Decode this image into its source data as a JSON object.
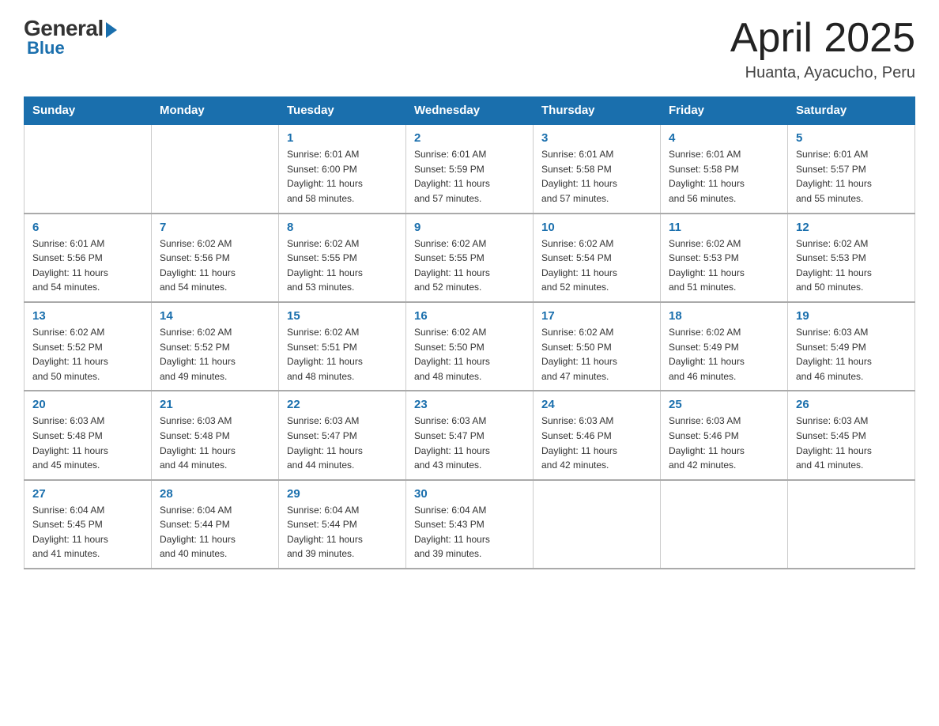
{
  "logo": {
    "general": "General",
    "blue": "Blue"
  },
  "title": {
    "month": "April 2025",
    "location": "Huanta, Ayacucho, Peru"
  },
  "days_header": [
    "Sunday",
    "Monday",
    "Tuesday",
    "Wednesday",
    "Thursday",
    "Friday",
    "Saturday"
  ],
  "weeks": [
    [
      {
        "day": "",
        "info": ""
      },
      {
        "day": "",
        "info": ""
      },
      {
        "day": "1",
        "info": "Sunrise: 6:01 AM\nSunset: 6:00 PM\nDaylight: 11 hours\nand 58 minutes."
      },
      {
        "day": "2",
        "info": "Sunrise: 6:01 AM\nSunset: 5:59 PM\nDaylight: 11 hours\nand 57 minutes."
      },
      {
        "day": "3",
        "info": "Sunrise: 6:01 AM\nSunset: 5:58 PM\nDaylight: 11 hours\nand 57 minutes."
      },
      {
        "day": "4",
        "info": "Sunrise: 6:01 AM\nSunset: 5:58 PM\nDaylight: 11 hours\nand 56 minutes."
      },
      {
        "day": "5",
        "info": "Sunrise: 6:01 AM\nSunset: 5:57 PM\nDaylight: 11 hours\nand 55 minutes."
      }
    ],
    [
      {
        "day": "6",
        "info": "Sunrise: 6:01 AM\nSunset: 5:56 PM\nDaylight: 11 hours\nand 54 minutes."
      },
      {
        "day": "7",
        "info": "Sunrise: 6:02 AM\nSunset: 5:56 PM\nDaylight: 11 hours\nand 54 minutes."
      },
      {
        "day": "8",
        "info": "Sunrise: 6:02 AM\nSunset: 5:55 PM\nDaylight: 11 hours\nand 53 minutes."
      },
      {
        "day": "9",
        "info": "Sunrise: 6:02 AM\nSunset: 5:55 PM\nDaylight: 11 hours\nand 52 minutes."
      },
      {
        "day": "10",
        "info": "Sunrise: 6:02 AM\nSunset: 5:54 PM\nDaylight: 11 hours\nand 52 minutes."
      },
      {
        "day": "11",
        "info": "Sunrise: 6:02 AM\nSunset: 5:53 PM\nDaylight: 11 hours\nand 51 minutes."
      },
      {
        "day": "12",
        "info": "Sunrise: 6:02 AM\nSunset: 5:53 PM\nDaylight: 11 hours\nand 50 minutes."
      }
    ],
    [
      {
        "day": "13",
        "info": "Sunrise: 6:02 AM\nSunset: 5:52 PM\nDaylight: 11 hours\nand 50 minutes."
      },
      {
        "day": "14",
        "info": "Sunrise: 6:02 AM\nSunset: 5:52 PM\nDaylight: 11 hours\nand 49 minutes."
      },
      {
        "day": "15",
        "info": "Sunrise: 6:02 AM\nSunset: 5:51 PM\nDaylight: 11 hours\nand 48 minutes."
      },
      {
        "day": "16",
        "info": "Sunrise: 6:02 AM\nSunset: 5:50 PM\nDaylight: 11 hours\nand 48 minutes."
      },
      {
        "day": "17",
        "info": "Sunrise: 6:02 AM\nSunset: 5:50 PM\nDaylight: 11 hours\nand 47 minutes."
      },
      {
        "day": "18",
        "info": "Sunrise: 6:02 AM\nSunset: 5:49 PM\nDaylight: 11 hours\nand 46 minutes."
      },
      {
        "day": "19",
        "info": "Sunrise: 6:03 AM\nSunset: 5:49 PM\nDaylight: 11 hours\nand 46 minutes."
      }
    ],
    [
      {
        "day": "20",
        "info": "Sunrise: 6:03 AM\nSunset: 5:48 PM\nDaylight: 11 hours\nand 45 minutes."
      },
      {
        "day": "21",
        "info": "Sunrise: 6:03 AM\nSunset: 5:48 PM\nDaylight: 11 hours\nand 44 minutes."
      },
      {
        "day": "22",
        "info": "Sunrise: 6:03 AM\nSunset: 5:47 PM\nDaylight: 11 hours\nand 44 minutes."
      },
      {
        "day": "23",
        "info": "Sunrise: 6:03 AM\nSunset: 5:47 PM\nDaylight: 11 hours\nand 43 minutes."
      },
      {
        "day": "24",
        "info": "Sunrise: 6:03 AM\nSunset: 5:46 PM\nDaylight: 11 hours\nand 42 minutes."
      },
      {
        "day": "25",
        "info": "Sunrise: 6:03 AM\nSunset: 5:46 PM\nDaylight: 11 hours\nand 42 minutes."
      },
      {
        "day": "26",
        "info": "Sunrise: 6:03 AM\nSunset: 5:45 PM\nDaylight: 11 hours\nand 41 minutes."
      }
    ],
    [
      {
        "day": "27",
        "info": "Sunrise: 6:04 AM\nSunset: 5:45 PM\nDaylight: 11 hours\nand 41 minutes."
      },
      {
        "day": "28",
        "info": "Sunrise: 6:04 AM\nSunset: 5:44 PM\nDaylight: 11 hours\nand 40 minutes."
      },
      {
        "day": "29",
        "info": "Sunrise: 6:04 AM\nSunset: 5:44 PM\nDaylight: 11 hours\nand 39 minutes."
      },
      {
        "day": "30",
        "info": "Sunrise: 6:04 AM\nSunset: 5:43 PM\nDaylight: 11 hours\nand 39 minutes."
      },
      {
        "day": "",
        "info": ""
      },
      {
        "day": "",
        "info": ""
      },
      {
        "day": "",
        "info": ""
      }
    ]
  ]
}
